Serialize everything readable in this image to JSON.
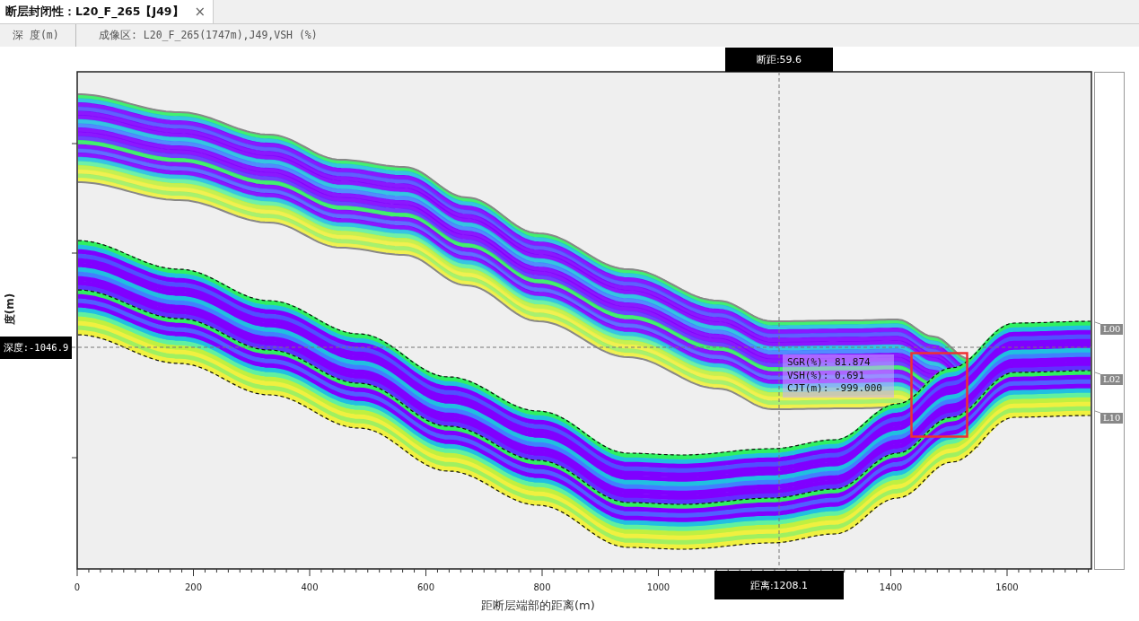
{
  "tab": {
    "title": "断层封闭性：L20_F_265【J49】",
    "close": "×"
  },
  "header": {
    "column_1": "深 度(m)",
    "column_2": "成像区: L20_F_265(1747m),J49,VSH (%)"
  },
  "chart": {
    "fault_throw": "断距:59.6",
    "depth_readout": "深度:-1046.9",
    "distance_readout": "距离:1208.1",
    "y_label": "度(m)",
    "x_label": "距断层端部的距离(m)",
    "x_ticks": [
      "0",
      "200",
      "400",
      "600",
      "800",
      "1000",
      "1400",
      "1600"
    ],
    "info": [
      "SGR(%): 81.874",
      "VSH(%): 0.691",
      "CJT(m): -999.000"
    ],
    "layers": [
      {
        "label": "L00"
      },
      {
        "label": "L02"
      },
      {
        "label": "L10"
      }
    ]
  }
}
